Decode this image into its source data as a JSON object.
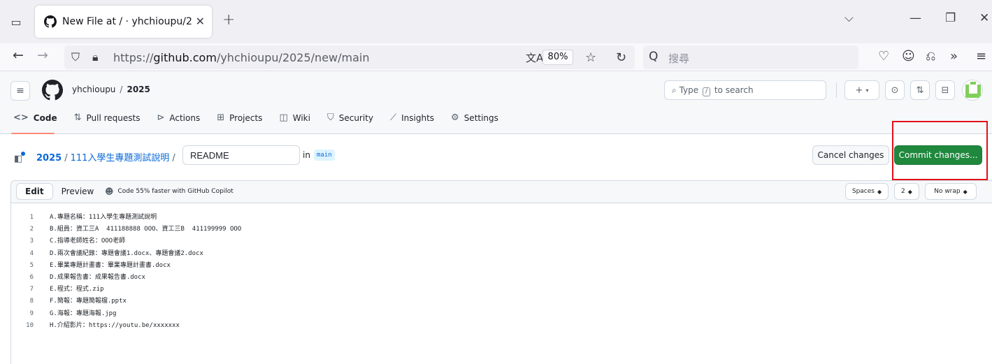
{
  "browser": {
    "tab_title": "New File at / · yhchioupu/2025",
    "url_prefix": "https://",
    "url_host": "github.com",
    "url_path": "/yhchioupu/2025/new/main",
    "zoom": "80%",
    "search_placeholder": "搜尋"
  },
  "header": {
    "owner": "yhchioupu",
    "separator": "/",
    "repo": "2025",
    "search_type": "Type",
    "search_key": "/",
    "search_suffix": "to search"
  },
  "repo_nav": [
    {
      "label": "Code",
      "icon": "code-icon"
    },
    {
      "label": "Pull requests",
      "icon": "pull-request-icon"
    },
    {
      "label": "Actions",
      "icon": "play-icon"
    },
    {
      "label": "Projects",
      "icon": "table-icon"
    },
    {
      "label": "Wiki",
      "icon": "book-icon"
    },
    {
      "label": "Security",
      "icon": "shield-icon"
    },
    {
      "label": "Insights",
      "icon": "graph-icon"
    },
    {
      "label": "Settings",
      "icon": "gear-icon"
    }
  ],
  "path": {
    "repo": "2025",
    "folder": "111入學生專題測試說明",
    "sep": "/",
    "filename": "README",
    "in_label": "in",
    "branch": "main"
  },
  "actions": {
    "cancel": "Cancel changes",
    "commit": "Commit changes..."
  },
  "editor": {
    "tab_edit": "Edit",
    "tab_preview": "Preview",
    "copilot_hint": "Code 55% faster with GitHub Copilot",
    "indent_mode": "Spaces",
    "indent_size": "2",
    "wrap_mode": "No wrap",
    "lines": [
      {
        "n": "1",
        "text": "A.專題名稱：111入學生專題測試說明"
      },
      {
        "n": "2",
        "text": "B.組員：資工三A  411188888 OOO、資工三B  411199999 OOO"
      },
      {
        "n": "3",
        "text": "C.指導老師姓名：OOO老師"
      },
      {
        "n": "4",
        "text": "D.兩次會議紀錄：專題會議1.docx、專題會議2.docx"
      },
      {
        "n": "5",
        "text": "E.畢業專題計畫書：畢業專題計畫書.docx"
      },
      {
        "n": "6",
        "text": "D.成果報告書：成果報告書.docx"
      },
      {
        "n": "7",
        "text": "E.程式：程式.zip"
      },
      {
        "n": "8",
        "text": "F.簡報：專題簡報檔.pptx"
      },
      {
        "n": "9",
        "text": "G.海報：專題海報.jpg"
      },
      {
        "n": "10",
        "text": "H.介紹影片：https://youtu.be/xxxxxxx"
      }
    ]
  },
  "colors": {
    "accent": "#0969da",
    "commit_green": "#1f883d",
    "highlight_red": "#e3101a",
    "underline": "#fd8c73"
  }
}
